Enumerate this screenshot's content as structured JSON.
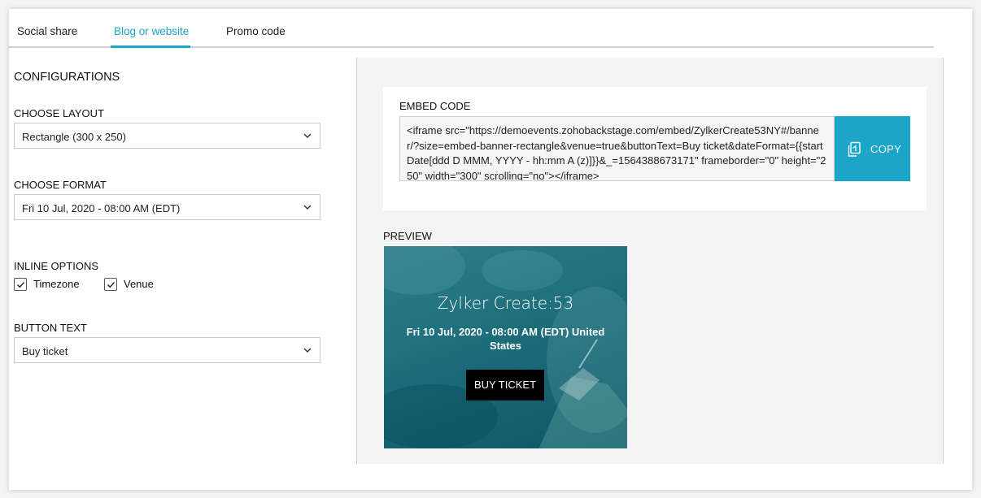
{
  "tabs": [
    {
      "label": "Social share"
    },
    {
      "label": "Blog or website"
    },
    {
      "label": "Promo code"
    }
  ],
  "config": {
    "heading": "CONFIGURATIONS",
    "layout_label": "CHOOSE LAYOUT",
    "layout_value": "Rectangle (300 x 250)",
    "format_label": "CHOOSE FORMAT",
    "format_value": "Fri 10 Jul, 2020 - 08:00 AM (EDT)",
    "inline_label": "INLINE OPTIONS",
    "timezone_label": "Timezone",
    "timezone_checked": true,
    "venue_label": "Venue",
    "venue_checked": true,
    "button_text_label": "BUTTON TEXT",
    "button_text_value": "Buy ticket"
  },
  "embed": {
    "title": "EMBED CODE",
    "code": "<iframe src=\"https://demoevents.zohobackstage.com/embed/ZylkerCreate53NY#/banner/?size=embed-banner-rectangle&venue=true&buttonText=Buy ticket&dateFormat={{startDate[ddd D MMM, YYYY - hh:mm A (z)]}}&_=1564388673171\" frameborder=\"0\" height=\"250\" width=\"300\" scrolling=\"no\"></iframe>",
    "copy_label": "COPY"
  },
  "preview": {
    "title": "PREVIEW",
    "event_name": "Zylker Create:53",
    "event_date": "Fri 10 Jul, 2020 - 08:00 AM (EDT) United States",
    "button_label": "BUY TICKET"
  },
  "colors": {
    "accent": "#1aa5c9",
    "banner_bg": "#1f6f7d"
  }
}
